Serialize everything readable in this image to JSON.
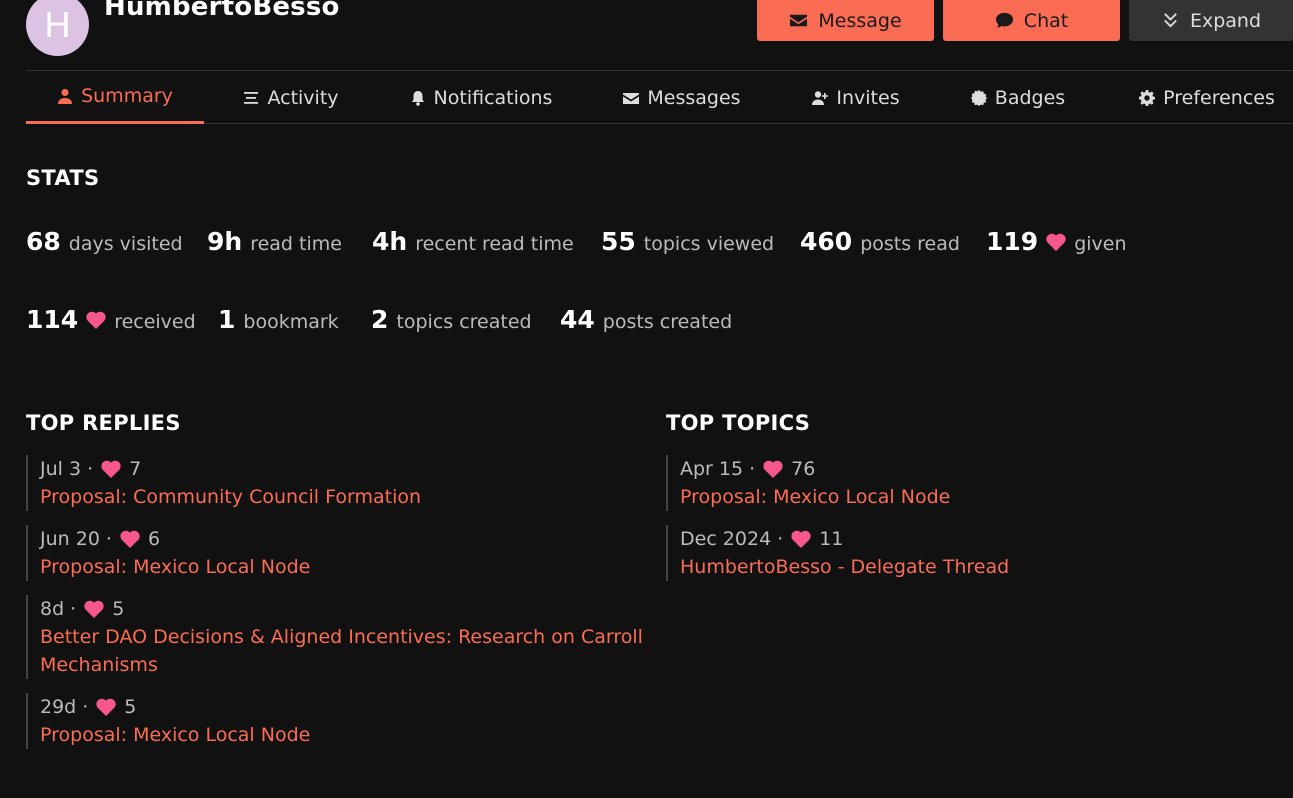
{
  "user": {
    "avatar_letter": "H",
    "username": "HumbertoBesso"
  },
  "header_buttons": {
    "message": "Message",
    "chat": "Chat",
    "expand": "Expand"
  },
  "tabs": [
    {
      "label": "Summary",
      "icon": "user-icon",
      "active": true
    },
    {
      "label": "Activity",
      "icon": "list-icon"
    },
    {
      "label": "Notifications",
      "icon": "bell-icon"
    },
    {
      "label": "Messages",
      "icon": "envelope-icon"
    },
    {
      "label": "Invites",
      "icon": "user-plus-icon"
    },
    {
      "label": "Badges",
      "icon": "certificate-icon"
    },
    {
      "label": "Preferences",
      "icon": "gear-icon"
    }
  ],
  "stats": {
    "title": "STATS",
    "items": [
      {
        "value": "68",
        "label": "days visited"
      },
      {
        "value": "9h",
        "label": "read time"
      },
      {
        "value": "4h",
        "label": "recent read time"
      },
      {
        "value": "55",
        "label": "topics viewed"
      },
      {
        "value": "460",
        "label": "posts read"
      },
      {
        "value": "119",
        "label": "given"
      },
      {
        "value": "114",
        "label": "received"
      },
      {
        "value": "1",
        "label": "bookmark"
      },
      {
        "value": "2",
        "label": "topics created"
      },
      {
        "value": "44",
        "label": "posts created"
      }
    ]
  },
  "top_replies": {
    "title": "TOP REPLIES",
    "items": [
      {
        "date": "Jul 3",
        "likes": "7",
        "title": "Proposal: Community Council Formation"
      },
      {
        "date": "Jun 20",
        "likes": "6",
        "title": "Proposal: Mexico Local Node"
      },
      {
        "date": "8d",
        "likes": "5",
        "title": "Better DAO Decisions & Aligned Incentives: Research on Carroll Mechanisms"
      },
      {
        "date": "29d",
        "likes": "5",
        "title": "Proposal: Mexico Local Node"
      }
    ]
  },
  "top_topics": {
    "title": "TOP TOPICS",
    "items": [
      {
        "date": "Apr 15",
        "likes": "76",
        "title": "Proposal: Mexico Local Node"
      },
      {
        "date": "Dec 2024",
        "likes": "11",
        "title": "HumbertoBesso - Delegate Thread"
      }
    ]
  },
  "colors": {
    "accent": "#fa6c54",
    "heart": "#f7578b",
    "background": "#111111"
  },
  "separator": "·"
}
